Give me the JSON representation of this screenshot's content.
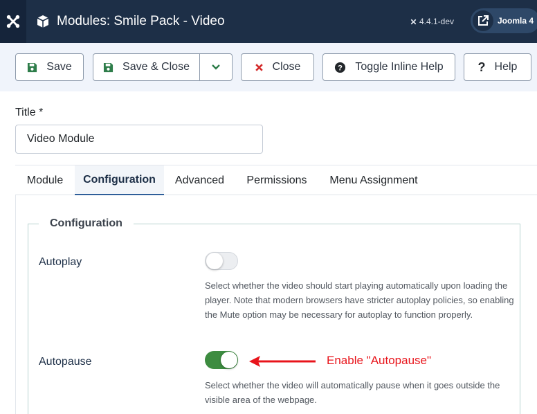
{
  "header": {
    "title": "Modules: Smile Pack - Video",
    "version": "4.4.1-dev",
    "site_name": "Joomla 4"
  },
  "toolbar": {
    "save_label": "Save",
    "save_close_label": "Save & Close",
    "close_label": "Close",
    "toggle_help_label": "Toggle Inline Help",
    "help_label": "Help"
  },
  "form": {
    "title_label": "Title *",
    "title_value": "Video Module"
  },
  "tabs": [
    {
      "label": "Module",
      "active": false
    },
    {
      "label": "Configuration",
      "active": true
    },
    {
      "label": "Advanced",
      "active": false
    },
    {
      "label": "Permissions",
      "active": false
    },
    {
      "label": "Menu Assignment",
      "active": false
    }
  ],
  "configuration": {
    "legend": "Configuration",
    "fields": [
      {
        "label": "Autoplay",
        "enabled": false,
        "description": "Select whether the video should start playing automatically upon loading the player. Note that modern browsers have stricter autoplay policies, so enabling the Mute option may be necessary for autoplay to function properly."
      },
      {
        "label": "Autopause",
        "enabled": true,
        "description": "Select whether the video will automatically pause when it goes outside the visible area of the webpage."
      }
    ]
  },
  "annotation": {
    "text": "Enable \"Autopause\"",
    "color": "#e8141b"
  },
  "colors": {
    "header_bg": "#1d2f47",
    "toggle_on": "#3d8c40",
    "save_icon": "#2e7d4a",
    "close_icon": "#d42b2b"
  }
}
